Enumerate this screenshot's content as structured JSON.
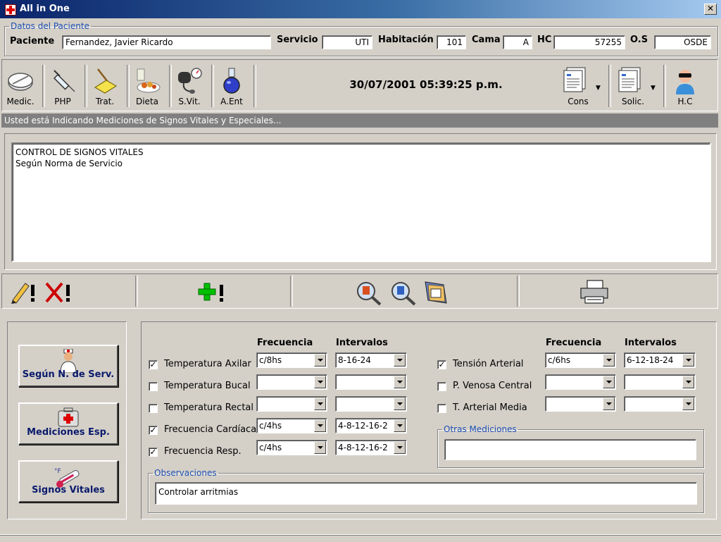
{
  "window": {
    "title": "All in One"
  },
  "patient": {
    "legend": "Datos del Paciente",
    "paciente_label": "Paciente",
    "paciente": "Fernandez, Javier Ricardo",
    "servicio_label": "Servicio",
    "servicio": "UTI",
    "habitacion_label": "Habitación",
    "habitacion": "101",
    "cama_label": "Cama",
    "cama": "A",
    "hc_label": "HC",
    "hc": "57255",
    "os_label": "O.S",
    "os": "OSDE"
  },
  "toolbar": {
    "items": [
      {
        "label": "Medic.",
        "icon": "pill-icon"
      },
      {
        "label": "PHP",
        "icon": "syringe-icon"
      },
      {
        "label": "Trat.",
        "icon": "broom-icon"
      },
      {
        "label": "Dieta",
        "icon": "food-icon"
      },
      {
        "label": "S.Vit.",
        "icon": "blood-pressure-icon"
      },
      {
        "label": "A.Ent",
        "icon": "flask-icon"
      }
    ],
    "datetime": "30/07/2001 05:39:25 p.m.",
    "right_items": [
      {
        "label": "Cons",
        "icon": "documents-icon"
      },
      {
        "label": "Solic.",
        "icon": "documents-icon"
      },
      {
        "label": "H.C",
        "icon": "doctor-icon"
      }
    ]
  },
  "status_text": "Usted está Indicando Mediciones de Signos Vitales y Especiales...",
  "memo": {
    "lines": [
      "CONTROL DE SIGNOS VITALES",
      "Según Norma de Servicio"
    ]
  },
  "left_buttons": [
    {
      "label": "Según N. de Serv.",
      "icon": "nurse-icon"
    },
    {
      "label": "Mediciones Esp.",
      "icon": "medkit-icon"
    },
    {
      "label": "Signos Vitales",
      "icon": "thermometer-icon"
    }
  ],
  "form": {
    "frecuencia_label": "Frecuencia",
    "intervalos_label": "Intervalos",
    "left_rows": [
      {
        "label": "Temperatura Axilar",
        "checked": true,
        "freq": "c/8hs",
        "interval": "8-16-24"
      },
      {
        "label": "Temperatura Bucal",
        "checked": false,
        "freq": "",
        "interval": ""
      },
      {
        "label": "Temperatura Rectal",
        "checked": false,
        "freq": "",
        "interval": ""
      },
      {
        "label": "Frecuencia Cardíaca",
        "checked": true,
        "freq": "c/4hs",
        "interval": "4-8-12-16-2"
      },
      {
        "label": "Frecuencia Resp.",
        "checked": true,
        "freq": "c/4hs",
        "interval": "4-8-12-16-2"
      }
    ],
    "right_rows": [
      {
        "label": "Tensión Arterial",
        "checked": true,
        "freq": "c/6hs",
        "interval": "6-12-18-24"
      },
      {
        "label": "P. Venosa Central",
        "checked": false,
        "freq": "",
        "interval": ""
      },
      {
        "label": "T. Arterial Media",
        "checked": false,
        "freq": "",
        "interval": ""
      }
    ],
    "otras_legend": "Otras Mediciones",
    "otras_value": "",
    "obs_legend": "Observaciones",
    "obs_value": "Controlar arritmias"
  }
}
